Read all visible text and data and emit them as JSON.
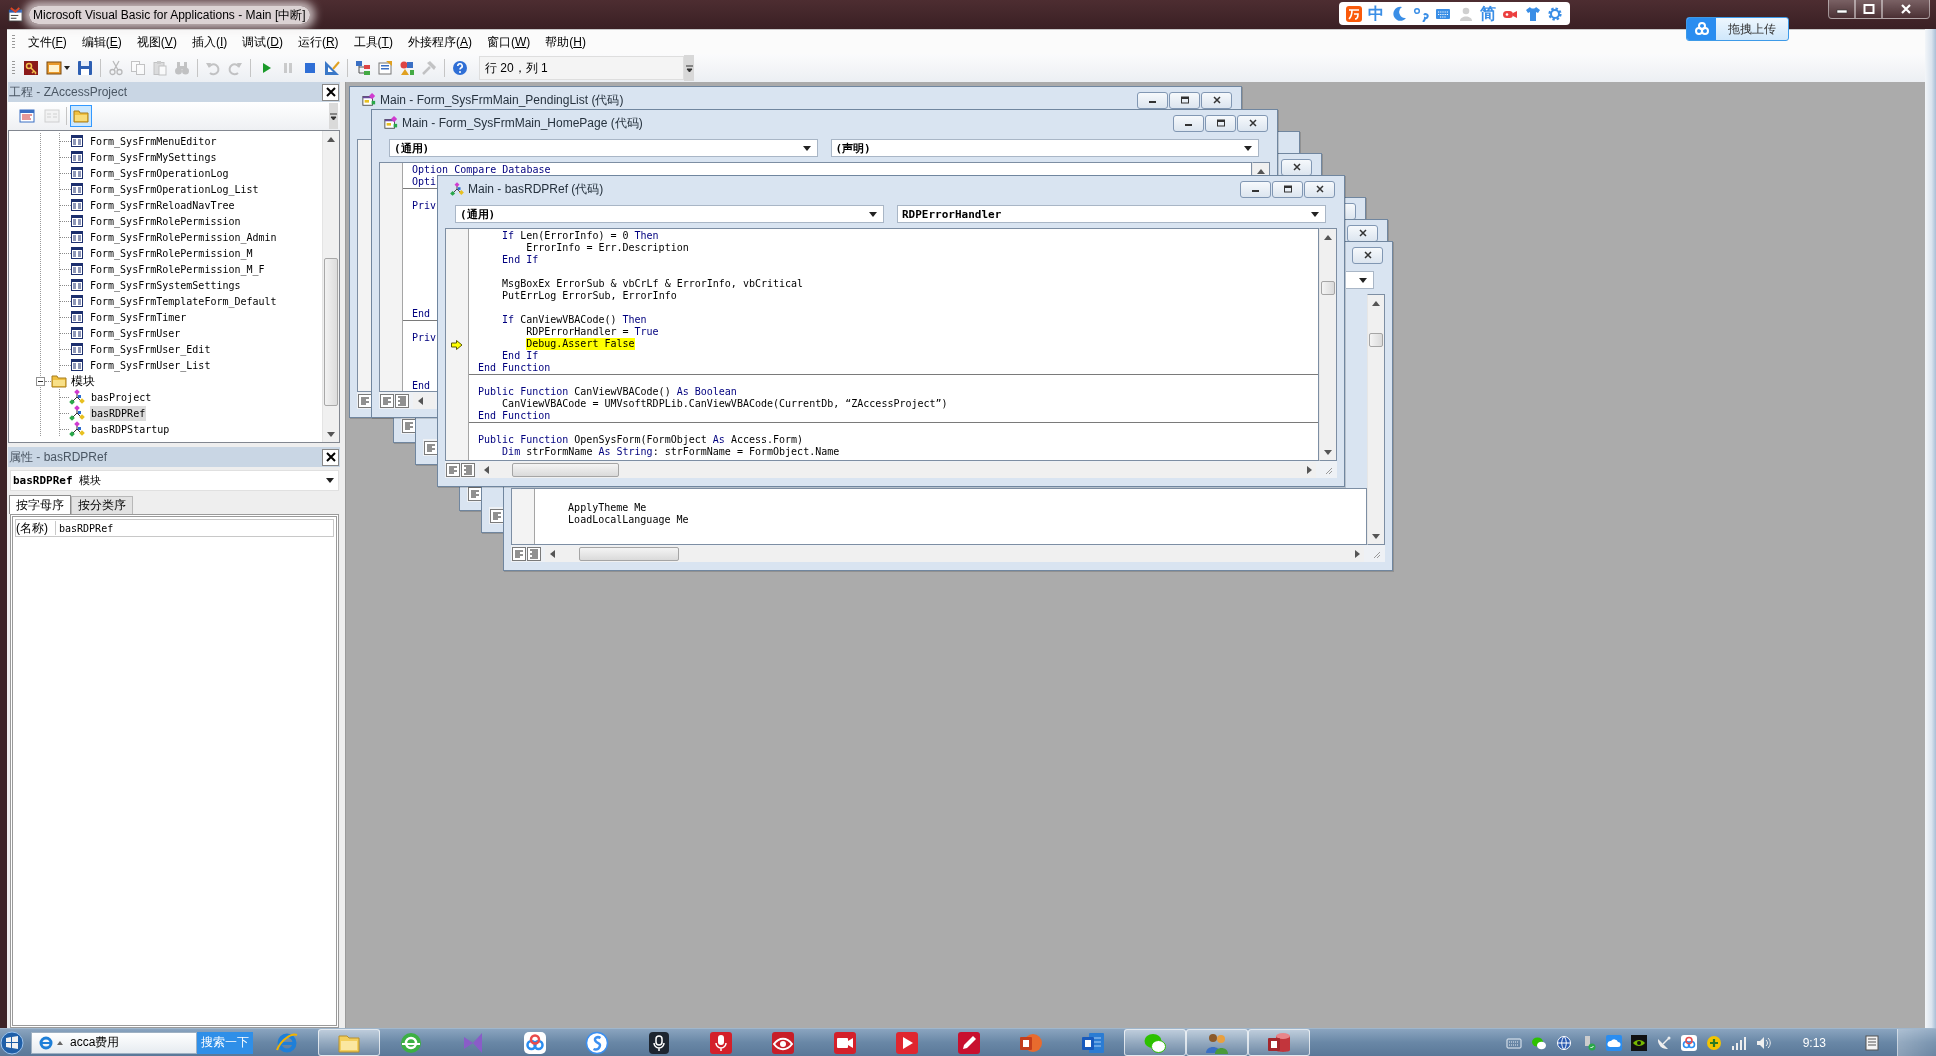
{
  "window": {
    "title": "Microsoft Visual Basic for Applications - Main [中断]"
  },
  "ime_toolbar": {
    "mode": "中",
    "script": "简"
  },
  "upload_widget": {
    "label": "拖拽上传"
  },
  "menu": [
    "文件(F)",
    "编辑(E)",
    "视图(V)",
    "插入(I)",
    "调试(D)",
    "运行(R)",
    "工具(T)",
    "外接程序(A)",
    "窗口(W)",
    "帮助(H)"
  ],
  "toolbar": {
    "buttons": [
      {
        "kind": "access",
        "disabled": false
      },
      {
        "kind": "userform",
        "disabled": false
      },
      {
        "kind": "save",
        "disabled": false
      },
      {
        "kind": "separator"
      },
      {
        "kind": "cut",
        "disabled": true
      },
      {
        "kind": "copy",
        "disabled": true
      },
      {
        "kind": "paste",
        "disabled": true
      },
      {
        "kind": "find",
        "disabled": true
      },
      {
        "kind": "separator"
      },
      {
        "kind": "undo",
        "disabled": true
      },
      {
        "kind": "redo",
        "disabled": true
      },
      {
        "kind": "separator"
      },
      {
        "kind": "run",
        "disabled": false
      },
      {
        "kind": "break",
        "disabled": true
      },
      {
        "kind": "reset",
        "disabled": false
      },
      {
        "kind": "design",
        "disabled": false
      },
      {
        "kind": "separator"
      },
      {
        "kind": "project",
        "disabled": false
      },
      {
        "kind": "properties",
        "disabled": false
      },
      {
        "kind": "browser",
        "disabled": false
      },
      {
        "kind": "toolbox",
        "disabled": true
      },
      {
        "kind": "separator"
      },
      {
        "kind": "help",
        "disabled": false
      }
    ],
    "position": "行 20，列 1"
  },
  "project_panel": {
    "title": "工程 - ZAccessProject",
    "tools": [
      {
        "kind": "code",
        "disabled": false,
        "pressed": false
      },
      {
        "kind": "object",
        "disabled": true,
        "pressed": false
      },
      {
        "kind": "separator"
      },
      {
        "kind": "folders",
        "disabled": false,
        "pressed": true
      }
    ],
    "tree": [
      {
        "children": [
          {
            "kind": "form",
            "label": "Form_SysFrmMenuEditor",
            "selected": false
          },
          {
            "kind": "form",
            "label": "Form_SysFrmMySettings",
            "selected": false
          },
          {
            "kind": "form",
            "label": "Form_SysFrmOperationLog",
            "selected": false
          },
          {
            "kind": "form",
            "label": "Form_SysFrmOperationLog_List",
            "selected": false
          },
          {
            "kind": "form",
            "label": "Form_SysFrmReloadNavTree",
            "selected": false
          },
          {
            "kind": "form",
            "label": "Form_SysFrmRolePermission",
            "selected": false
          },
          {
            "kind": "form",
            "label": "Form_SysFrmRolePermission_Admin",
            "selected": false
          },
          {
            "kind": "form",
            "label": "Form_SysFrmRolePermission_M",
            "selected": false
          },
          {
            "kind": "form",
            "label": "Form_SysFrmRolePermission_M_F",
            "selected": false
          },
          {
            "kind": "form",
            "label": "Form_SysFrmSystemSettings",
            "selected": false
          },
          {
            "kind": "form",
            "label": "Form_SysFrmTemplateForm_Default",
            "selected": false
          },
          {
            "kind": "form",
            "label": "Form_SysFrmTimer",
            "selected": false
          },
          {
            "kind": "form",
            "label": "Form_SysFrmUser",
            "selected": false
          },
          {
            "kind": "form",
            "label": "Form_SysFrmUser_Edit",
            "selected": false
          },
          {
            "kind": "form",
            "label": "Form_SysFrmUser_List",
            "selected": false
          }
        ]
      },
      {
        "kind": "folder",
        "label": "模块",
        "expanded": true,
        "selected": false,
        "children": [
          {
            "kind": "module",
            "label": "basProject",
            "selected": false
          },
          {
            "kind": "module",
            "label": "basRDPRef",
            "selected": true
          },
          {
            "kind": "module",
            "label": "basRDPStartup",
            "selected": false
          }
        ]
      }
    ]
  },
  "properties_panel": {
    "title": "属性 - basRDPRef",
    "object": "**basRDPRef** 模块",
    "tabs": [
      {
        "label": "按字母序",
        "selected": true
      },
      {
        "label": "按分类序",
        "selected": false
      }
    ],
    "rows": [
      {
        "name": "(名称)",
        "value": "basRDPRef"
      }
    ]
  },
  "code_windows": [
    {
      "kind": "form",
      "title": "Main - Form_SysFrmMain_PendingList (代码)"
    },
    {
      "kind": "form",
      "title": "Main - Form_SysFrmMain_HomePage (代码)",
      "object": "(通用)",
      "procedure": "(声明)",
      "lines": [
        {
          "current": false,
          "segments": [
            {
              "kind": "keyword",
              "text": "Option Compare Database"
            }
          ]
        },
        {
          "current": false,
          "segments": [
            {
              "kind": "keyword",
              "text": "Opti"
            }
          ]
        },
        {
          "current": false,
          "segments": [
            {
              "kind": "keyword",
              "text": "Priv"
            }
          ]
        },
        {
          "current": false,
          "segments": [
            {
              "kind": "keyword",
              "text": "End"
            }
          ]
        },
        {
          "current": false,
          "segments": [
            {
              "kind": "keyword",
              "text": "Priv"
            }
          ]
        },
        {
          "current": false,
          "segments": [
            {
              "kind": "keyword",
              "text": "End"
            }
          ]
        }
      ]
    },
    {
      "kind": "module",
      "title": "Main - basRDPRef (代码)",
      "object": "(通用)",
      "procedure": "RDPErrorHandler",
      "lines": [
        {
          "current": false,
          "segments": [
            {
              "kind": "keyword",
              "text": "    If"
            },
            {
              "kind": "plain",
              "text": " Len(ErrorInfo) = 0 "
            },
            {
              "kind": "keyword",
              "text": "Then"
            }
          ]
        },
        {
          "current": false,
          "segments": [
            {
              "kind": "plain",
              "text": "        ErrorInfo = Err.Description"
            }
          ]
        },
        {
          "current": false,
          "segments": [
            {
              "kind": "keyword",
              "text": "    End If"
            }
          ]
        },
        {
          "current": false,
          "segments": [
            {
              "kind": "plain",
              "text": "    MsgBoxEx ErrorSub & vbCrLf & ErrorInfo, vbCritical"
            }
          ]
        },
        {
          "current": false,
          "segments": [
            {
              "kind": "plain",
              "text": "    PutErrLog ErrorSub, ErrorInfo"
            }
          ]
        },
        {
          "current": false,
          "segments": [
            {
              "kind": "keyword",
              "text": "    If"
            },
            {
              "kind": "plain",
              "text": " CanViewVBACode() "
            },
            {
              "kind": "keyword",
              "text": "Then"
            }
          ]
        },
        {
          "current": false,
          "segments": [
            {
              "kind": "plain",
              "text": "        RDPErrorHandler = "
            },
            {
              "kind": "keyword",
              "text": "True"
            }
          ]
        },
        {
          "current": true,
          "segments": [
            {
              "kind": "plain",
              "text": "        Debug.Assert False"
            }
          ]
        },
        {
          "current": false,
          "segments": [
            {
              "kind": "keyword",
              "text": "    End If"
            }
          ]
        },
        {
          "current": false,
          "segments": [
            {
              "kind": "keyword",
              "text": "End Function"
            }
          ]
        },
        {
          "current": false,
          "segments": [
            {
              "kind": "keyword",
              "text": "Public Function"
            },
            {
              "kind": "plain",
              "text": " CanViewVBACode() "
            },
            {
              "kind": "keyword",
              "text": "As Boolean"
            }
          ]
        },
        {
          "current": false,
          "segments": [
            {
              "kind": "plain",
              "text": "    CanViewVBACode = UMVsoftRDPLib.CanViewVBACode(CurrentDb, “ZAccessProject”)"
            }
          ]
        },
        {
          "current": false,
          "segments": [
            {
              "kind": "keyword",
              "text": "End Function"
            }
          ]
        },
        {
          "current": false,
          "segments": [
            {
              "kind": "keyword",
              "text": "Public Function"
            },
            {
              "kind": "plain",
              "text": " OpenSysForm(FormObject "
            },
            {
              "kind": "keyword",
              "text": "As"
            },
            {
              "kind": "plain",
              "text": " Access.Form)"
            }
          ]
        },
        {
          "current": false,
          "segments": [
            {
              "kind": "keyword",
              "text": "    Dim"
            },
            {
              "kind": "plain",
              "text": " strFormName "
            },
            {
              "kind": "keyword",
              "text": "As String"
            },
            {
              "kind": "plain",
              "text": ": strFormName = FormObject.Name"
            }
          ]
        }
      ]
    },
    {
      "lines": [
        {
          "current": false,
          "segments": [
            {
              "kind": "plain",
              "text": "    ApplyTheme Me"
            }
          ]
        },
        {
          "current": false,
          "segments": [
            {
              "kind": "plain",
              "text": "    LoadLocalLanguage Me"
            }
          ]
        }
      ]
    }
  ],
  "taskbar": {
    "search": {
      "value": "acca费用"
    },
    "search_button": "搜索一下",
    "apps": [
      {
        "kind": "ie",
        "running": false
      },
      {
        "kind": "explorer",
        "running": true
      },
      {
        "kind": "browser360",
        "running": false
      },
      {
        "kind": "studio",
        "running": false
      },
      {
        "kind": "netdisk",
        "running": false
      },
      {
        "kind": "sogou",
        "running": false
      },
      {
        "kind": "recorder",
        "running": false
      },
      {
        "kind": "redmic",
        "running": false
      },
      {
        "kind": "eye",
        "running": false
      },
      {
        "kind": "camera",
        "running": false
      },
      {
        "kind": "player",
        "running": false
      },
      {
        "kind": "pdf",
        "running": false
      },
      {
        "kind": "slides",
        "running": false
      },
      {
        "kind": "word",
        "running": false
      },
      {
        "kind": "wechat",
        "running": true
      },
      {
        "kind": "people",
        "running": true
      },
      {
        "kind": "access",
        "running": true
      }
    ],
    "clock": "9:13"
  }
}
